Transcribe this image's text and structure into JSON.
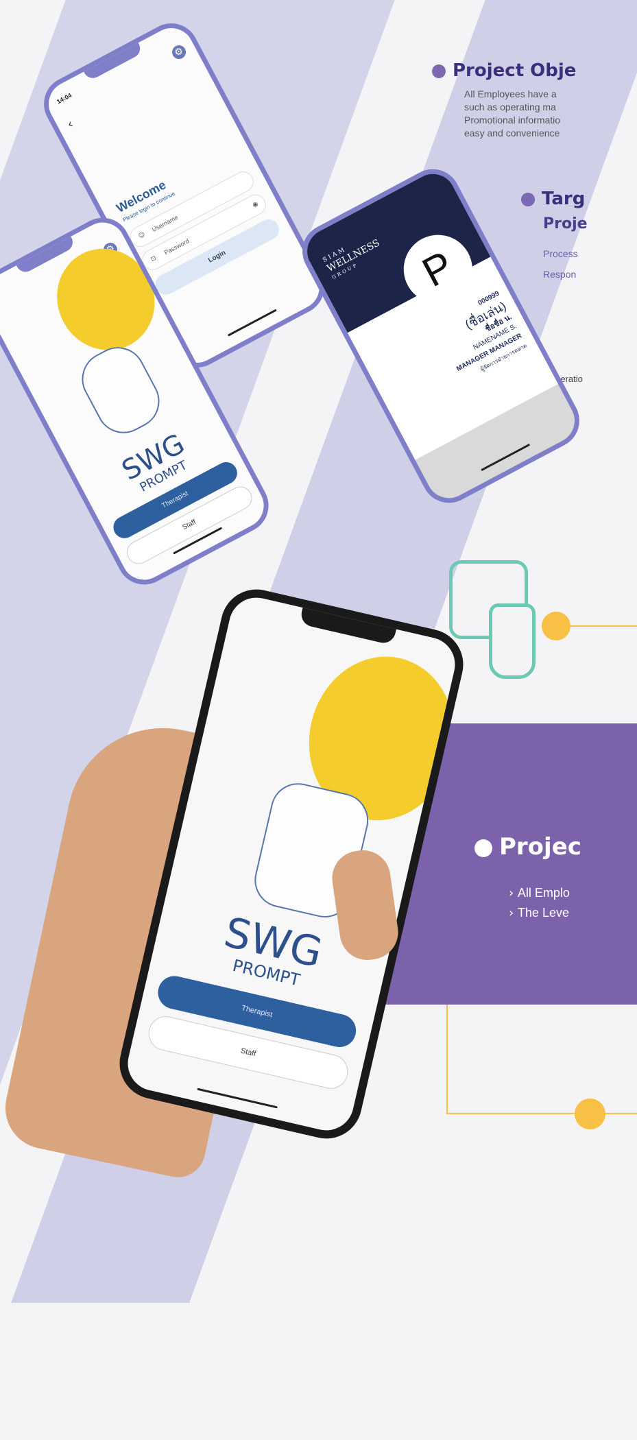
{
  "objective": {
    "title": "Project Obje",
    "lines": [
      "All Employees have a",
      "such as operating ma",
      "Promotional informatio",
      "easy and convenience"
    ]
  },
  "target": {
    "title": "Targ",
    "subtitle": "Proje",
    "lines": [
      "Process",
      "Respon"
    ],
    "footer": "Operatio"
  },
  "project": {
    "title": "Projec",
    "items": [
      "All Emplo",
      "The Leve"
    ]
  },
  "login_screen": {
    "time": "14:04",
    "welcome": "Welcome",
    "subtitle": "Please login to continue",
    "username_placeholder": "Username",
    "password_placeholder": "Password",
    "login_label": "Login"
  },
  "splash_screen": {
    "logo_main": "SWG",
    "logo_sub": "PROMPT",
    "therapist_label": "Therapist",
    "staff_label": "Staff"
  },
  "card_screen": {
    "brand_top": "SIAM",
    "brand_main": "WELLNESS",
    "brand_bottom": "GROUP",
    "avatar_letter": "P",
    "employee_id": "000999",
    "nickname": "(ชื่อเล่น)",
    "name_th": "ชื่อชื่อ น.",
    "name_en": "NAMENAME S.",
    "position_en": "MANAGER MANAGER",
    "position_th": "ผู้จัดการฝ่ายการตลาด"
  },
  "colors": {
    "band": "#cfcfe8",
    "purple_panel": "#7b62ab",
    "phone_frame": "#7f7fc9",
    "accent_orange": "#f8c146",
    "teal_icon": "#6cc9b4",
    "primary_blue": "#2e5f9e"
  }
}
